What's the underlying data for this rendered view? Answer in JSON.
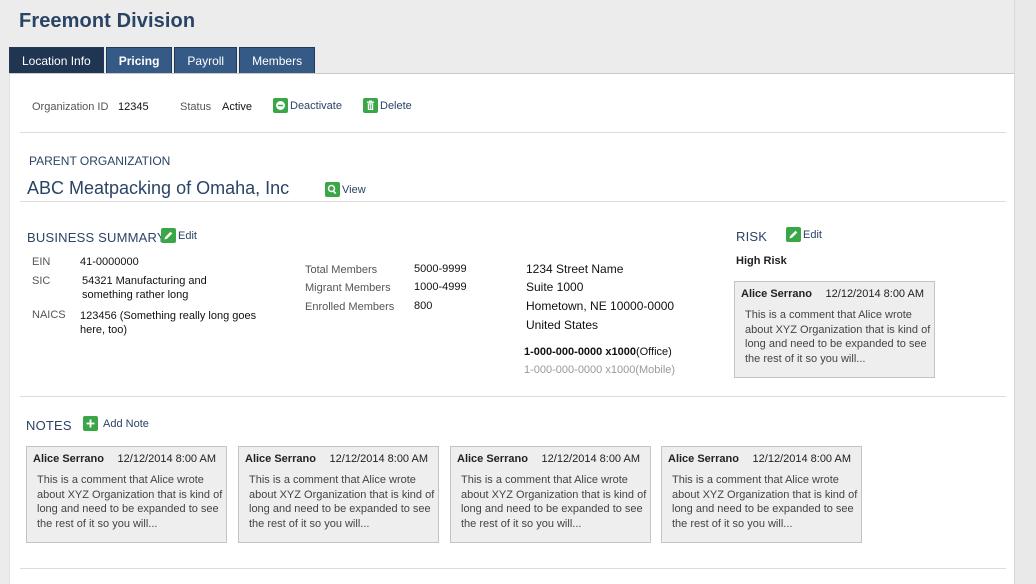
{
  "page": {
    "title": "Freemont Division"
  },
  "tabs": [
    {
      "label": "Location Info"
    },
    {
      "label": "Pricing"
    },
    {
      "label": "Payroll"
    },
    {
      "label": "Members"
    }
  ],
  "org_bar": {
    "org_id_label": "Organization ID",
    "org_id_value": "12345",
    "status_label": "Status",
    "status_value": "Active",
    "deactivate_label": "Deactivate",
    "delete_label": "Delete"
  },
  "parent": {
    "heading": "PARENT ORGANIZATION",
    "name": "ABC Meatpacking of Omaha, Inc",
    "view_label": "View"
  },
  "business_summary": {
    "heading": "BUSINESS SUMMARY",
    "edit_label": "Edit",
    "ein_label": "EIN",
    "ein_value": "41-0000000",
    "sic_label": "SIC",
    "sic_line1": "54321 Manufacturing and",
    "sic_line2": "something rather long",
    "naics_label": "NAICS",
    "naics_line1": "123456 (Something really long goes",
    "naics_line2": "here, too)",
    "total_members_label": "Total Members",
    "total_members_value": "5000-9999",
    "migrant_members_label": "Migrant Members",
    "migrant_members_value": "1000-4999",
    "enrolled_members_label": "Enrolled Members",
    "enrolled_members_value": "800",
    "address_line1": "1234 Street Name",
    "address_line2": "Suite 1000",
    "address_line3": "Hometown, NE  10000-0000",
    "address_line4": "United States",
    "phone_office_number": "1-000-000-0000",
    "phone_office_ext": " x1000",
    "phone_office_type": "(Office)",
    "phone_mobile_number": "1-000-000-0000",
    "phone_mobile_ext": " x1000",
    "phone_mobile_type": "(Mobile)"
  },
  "risk": {
    "heading": "RISK",
    "edit_label": "Edit",
    "level": "High Risk",
    "comment": {
      "author": "Alice Serrano",
      "date": "12/12/2014 8:00 AM",
      "body": "This is a comment that Alice wrote about XYZ Organization that is kind of long and need to be expanded to see the rest of it so you will..."
    }
  },
  "notes": {
    "heading": "NOTES",
    "add_label": "Add Note",
    "items": [
      {
        "author": "Alice Serrano",
        "date": "12/12/2014 8:00 AM",
        "body": "This is a comment that Alice wrote about XYZ Organization that is kind of long and need to be expanded to see the rest of it so you will..."
      },
      {
        "author": "Alice Serrano",
        "date": "12/12/2014 8:00 AM",
        "body": "This is a comment that Alice wrote about XYZ Organization that is kind of long and need to be expanded to see the rest of it so you will..."
      },
      {
        "author": "Alice Serrano",
        "date": "12/12/2014 8:00 AM",
        "body": "This is a comment that Alice wrote about XYZ Organization that is kind of long and need to be expanded to see the rest of it so you will..."
      },
      {
        "author": "Alice Serrano",
        "date": "12/12/2014 8:00 AM",
        "body": "This is a comment that Alice wrote about XYZ Organization that is kind of long and need to be expanded to see the rest of it so you will..."
      }
    ]
  },
  "colors": {
    "tab_bg": "#365a86",
    "tab_active_bg": "#1f3552",
    "heading_blue": "#2a4466",
    "action_green": "#3aa648"
  }
}
